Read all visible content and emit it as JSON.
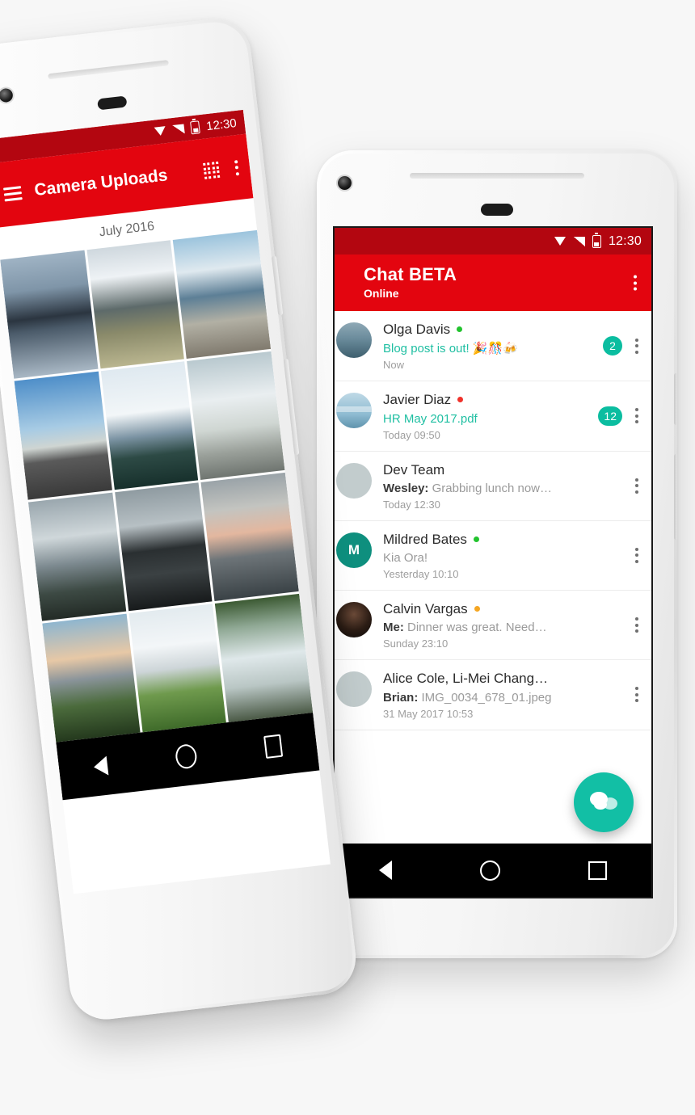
{
  "colors": {
    "brand_red": "#e3050f",
    "status_bar_red": "#b30610",
    "accent_teal": "#0bbda0",
    "fab_teal": "#12bfa5",
    "online_green": "#22c32e",
    "busy_red": "#f0322b",
    "away_orange": "#f5a623"
  },
  "left_phone": {
    "status_bar": {
      "time": "12:30",
      "icons": [
        "wifi-icon",
        "signal-icon",
        "battery-icon"
      ]
    },
    "app_bar": {
      "menu_icon": "hamburger-icon",
      "title": "Camera Uploads",
      "grid_icon": "grid-view-icon",
      "overflow_icon": "overflow-menu-icon"
    },
    "section_header": "July 2016",
    "photos": [
      {
        "alt": "Mirror lake mountains at dusk",
        "tone": "mountain-reflection"
      },
      {
        "alt": "Cloudy fjord river valley",
        "tone": "fjord-clouds"
      },
      {
        "alt": "Lake shore with driftwood",
        "tone": "lake-shore"
      },
      {
        "alt": "Empty road towards mountains",
        "tone": "open-road"
      },
      {
        "alt": "Snow capped peak in cloud",
        "tone": "snow-peak"
      },
      {
        "alt": "Geyser steam over rocks",
        "tone": "geyser"
      },
      {
        "alt": "Sun rays over rocky coast",
        "tone": "coast-rays"
      },
      {
        "alt": "Dark headland reflected in water",
        "tone": "headland"
      },
      {
        "alt": "Pink sunset over sea cliffs",
        "tone": "sunset-cliffs"
      },
      {
        "alt": "City skyline from green hill",
        "tone": "city-hill"
      },
      {
        "alt": "Volcanic crater over city",
        "tone": "crater"
      },
      {
        "alt": "Forest waterfall",
        "tone": "waterfall"
      }
    ],
    "nav_bar": {
      "back": "back-icon",
      "home": "home-icon",
      "recents": "recents-icon"
    }
  },
  "right_phone": {
    "status_bar": {
      "time": "12:30",
      "icons": [
        "wifi-icon",
        "signal-icon",
        "battery-icon"
      ]
    },
    "app_bar": {
      "title": "Chat BETA",
      "subtitle": "Online",
      "overflow_icon": "overflow-menu-icon"
    },
    "chats": [
      {
        "name": "Olga Davis",
        "presence": "online",
        "presence_color": "#22c32e",
        "snippet": "Blog post is out! 🎉🎊🍻",
        "snippet_unread": true,
        "sender": "",
        "time": "Now",
        "badge": "2",
        "avatar": "photo-landscape"
      },
      {
        "name": "Javier Diaz",
        "presence": "busy",
        "presence_color": "#f0322b",
        "snippet": "HR May 2017.pdf",
        "snippet_unread": true,
        "sender": "",
        "time": "Today 09:50",
        "badge": "12",
        "avatar": "photo-boat"
      },
      {
        "name": "Dev Team",
        "presence": "none",
        "presence_color": "",
        "snippet": "Grabbing lunch now…",
        "snippet_unread": false,
        "sender": "Wesley:",
        "time": "Today 12:30",
        "badge": "",
        "avatar": "group-placeholder"
      },
      {
        "name": "Mildred Bates",
        "presence": "online",
        "presence_color": "#22c32e",
        "snippet": "Kia Ora!",
        "snippet_unread": false,
        "sender": "",
        "time": "Yesterday 10:10",
        "badge": "",
        "avatar": "initial-M"
      },
      {
        "name": "Calvin Vargas",
        "presence": "away",
        "presence_color": "#f5a623",
        "snippet": "Dinner was great. Need…",
        "snippet_unread": false,
        "sender": "Me:",
        "time": "Sunday 23:10",
        "badge": "",
        "avatar": "photo-portrait"
      },
      {
        "name": "Alice Cole, Li-Mei Chang…",
        "presence": "none",
        "presence_color": "",
        "snippet": "IMG_0034_678_01.jpeg",
        "snippet_unread": false,
        "sender": "Brian:",
        "time": "31 May 2017 10:53",
        "badge": "",
        "avatar": "group-placeholder"
      }
    ],
    "fab": {
      "icon": "chat-bubbles-icon",
      "label": "New chat"
    },
    "nav_bar": {
      "back": "back-icon",
      "home": "home-icon",
      "recents": "recents-icon"
    },
    "avatar_initials": {
      "mildred": "M"
    }
  }
}
